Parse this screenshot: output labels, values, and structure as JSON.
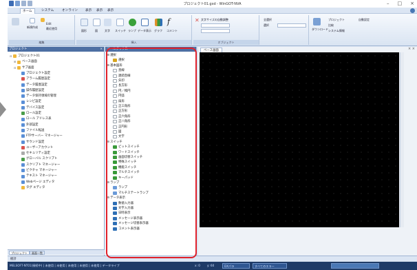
{
  "app": {
    "title": "プロジェクト01.gxd - WinGOT-NVA",
    "window_controls": [
      "–",
      "□",
      "×"
    ]
  },
  "tabs": [
    "ホーム",
    "システム",
    "オンライン",
    "表示",
    "表示",
    "表示"
  ],
  "ribbon": {
    "labels": {
      "new_file": "新規作成",
      "edit": "Edit",
      "recent": "最近使用",
      "shape1": "図形",
      "shape2": "図",
      "text": "文字",
      "switch": "スイッチ",
      "lamp": "ランプ",
      "data": "データ表示",
      "graph": "グラフ",
      "comment": "コメント",
      "text_size": "文字サイズの自動調整",
      "group_label_edit": "編集",
      "group_label_insert": "挿入",
      "group_label_object": "オブジェクト",
      "select_all": "全選択",
      "select": "選択",
      "download": "ダウンロード",
      "project": "プロジェクト",
      "compare": "比較",
      "system_info": "システム情報",
      "auto_setting": "自動設定"
    }
  },
  "project_panel": {
    "title": "プロジェクト",
    "tree": [
      {
        "label": "プロジェクト01",
        "indent": 0,
        "exp": "⊟",
        "color": "#f0b83c"
      },
      {
        "label": "ベース画面",
        "indent": 1,
        "exp": "⊞",
        "color": "#f0b83c"
      },
      {
        "label": "サブ画面",
        "indent": 1,
        "exp": "⊟",
        "color": "#f0b83c"
      },
      {
        "label": "プロジェクト設定",
        "indent": 2,
        "exp": "",
        "color": "#5a8fd6"
      },
      {
        "label": "アラーム履歴設定",
        "indent": 2,
        "exp": "",
        "color": "#d9534f"
      },
      {
        "label": "データ履歴設定",
        "indent": 2,
        "exp": "",
        "color": "#5a8fd6"
      },
      {
        "label": "操作履歴設定",
        "indent": 2,
        "exp": "",
        "color": "#5a8fd6"
      },
      {
        "label": "データ保持領域の管理",
        "indent": 2,
        "exp": "",
        "color": "#5a8fd6"
      },
      {
        "label": "レシピ設定",
        "indent": 2,
        "exp": "",
        "color": "#5a8fd6"
      },
      {
        "label": "デバイス設定",
        "indent": 2,
        "exp": "",
        "color": "#5a8fd6"
      },
      {
        "label": "ロール設定",
        "indent": 2,
        "exp": "",
        "color": "#4a9d4a"
      },
      {
        "label": "ロール アドレス表",
        "indent": 2,
        "exp": "",
        "color": "#5a8fd6"
      },
      {
        "label": "外部設定",
        "indent": 2,
        "exp": "",
        "color": "#5a8fd6"
      },
      {
        "label": "ファイル転送",
        "indent": 2,
        "exp": "",
        "color": "#5a8fd6"
      },
      {
        "label": "FTPサーバー マネージャー",
        "indent": 2,
        "exp": "",
        "color": "#5a8fd6"
      },
      {
        "label": "サウンド設定",
        "indent": 2,
        "exp": "",
        "color": "#5a8fd6"
      },
      {
        "label": "ユーザーアカウント",
        "indent": 2,
        "exp": "",
        "color": "#d9534f"
      },
      {
        "label": "セキュリティ設定",
        "indent": 2,
        "exp": "",
        "color": "#aaaaaa"
      },
      {
        "label": "グローバル スクリプト",
        "indent": 2,
        "exp": "",
        "color": "#4a9d4a"
      },
      {
        "label": "スクリプト マネージャー",
        "indent": 2,
        "exp": "",
        "color": "#5a8fd6"
      },
      {
        "label": "ピクチャ マネージャー",
        "indent": 2,
        "exp": "",
        "color": "#5a8fd6"
      },
      {
        "label": "テキスト マネージャー",
        "indent": 2,
        "exp": "",
        "color": "#5a8fd6"
      },
      {
        "label": "Webページ エディタ",
        "indent": 2,
        "exp": "",
        "color": "#5a8fd6"
      },
      {
        "label": "タグ エディタ",
        "indent": 2,
        "exp": "",
        "color": "#f0b83c"
      }
    ],
    "bottom_tabs": [
      "プロジェクト",
      "画面一覧"
    ]
  },
  "toolbox": {
    "title": "ツールボックス",
    "sections": [
      {
        "name": "選択",
        "items": [
          "選択"
        ]
      },
      {
        "name": "基本図形",
        "items": [
          "直線",
          "連続直線",
          "矢印",
          "長方形",
          "円／楕円",
          "円弧",
          "扇形",
          "正三角形",
          "正方形",
          "正六角形",
          "正八角形",
          "正円形",
          "図",
          "文字"
        ]
      },
      {
        "name": "スイッチ",
        "items": [
          "ビットスイッチ",
          "ワードスイッチ",
          "画面切替スイッチ",
          "特殊スイッチ",
          "機能スイッチ",
          "マルチスイッチ",
          "キーパッド"
        ]
      },
      {
        "name": "ランプ",
        "items": [
          "ランプ",
          "マルチステートランプ"
        ]
      },
      {
        "name": "データ表示",
        "items": [
          "数値入力器",
          "文字入力器",
          "日時表示",
          "メッセージ表示器",
          "メッセージ切替表示器",
          "コメント表示器"
        ]
      }
    ],
    "colors": {
      "select": "#d6a520",
      "shape": "#9aa3ad",
      "switch": "#3a9a3a",
      "lamp": "#6a9ad8",
      "data": "#2e6fb5"
    }
  },
  "editor": {
    "doc_tab": "ベース画面",
    "close_symbol": "× ×"
  },
  "status": {
    "left": "統計",
    "segments": [
      "MELSOFT-NT01(接続中) | 未使用 | 未使用 | 未使用 | 未使用 | 未使用 | データライブ",
      "x: 0",
      "y: 60",
      "DXパラ",
      "すべてのエラー"
    ]
  },
  "colors": {
    "accent": "#4d6fa3",
    "highlight": "#e0202a",
    "canvas": "#000000"
  }
}
